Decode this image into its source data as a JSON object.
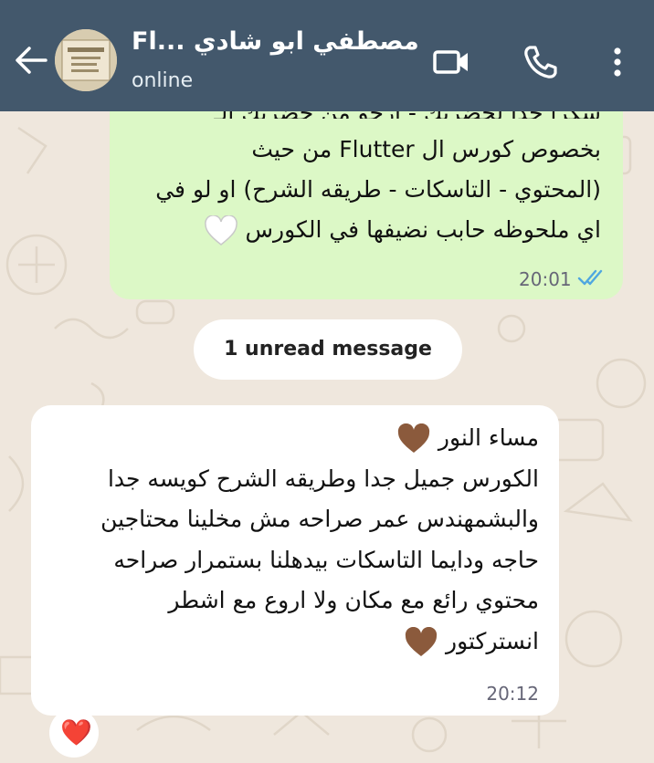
{
  "header": {
    "contact_name": "مصطفي ابو شادي ...Fl",
    "status": "online"
  },
  "messages": {
    "outgoing": {
      "partial_top_line": "شكراً جداً لحضرتك - أرجو من حضرتك الـ feedback",
      "lines": [
        "بخصوص كورس ال Flutter   من حيث",
        "(المحتوي - التاسكات - طريقه الشرح) او لو في",
        "اي ملحوظه حابب نضيفها في الكورس"
      ],
      "emoji": "white-heart",
      "time": "20:01",
      "status": "read"
    },
    "unread_divider": "1 unread message",
    "incoming": {
      "lines": [
        "مساء النور",
        "الكورس جميل جدا وطريقه الشرح كويسه جدا",
        "والبشمهندس عمر صراحه مش مخلينا محتاجين",
        "حاجه ودايما التاسكات بيدهلنا بستمرار صراحه",
        "محتوي رائع مع مكان ولا اروع مع اشطر",
        "انستركتور"
      ],
      "emoji": "brown-heart",
      "time": "20:12",
      "reaction": "❤️"
    }
  },
  "colors": {
    "header": "#43586c",
    "wallpaper": "#efe7dd",
    "outgoing_bubble": "#dcf8c6",
    "incoming_bubble": "#ffffff",
    "read_ticks": "#4fa7e0",
    "brown_heart": "#8b5a3c"
  }
}
